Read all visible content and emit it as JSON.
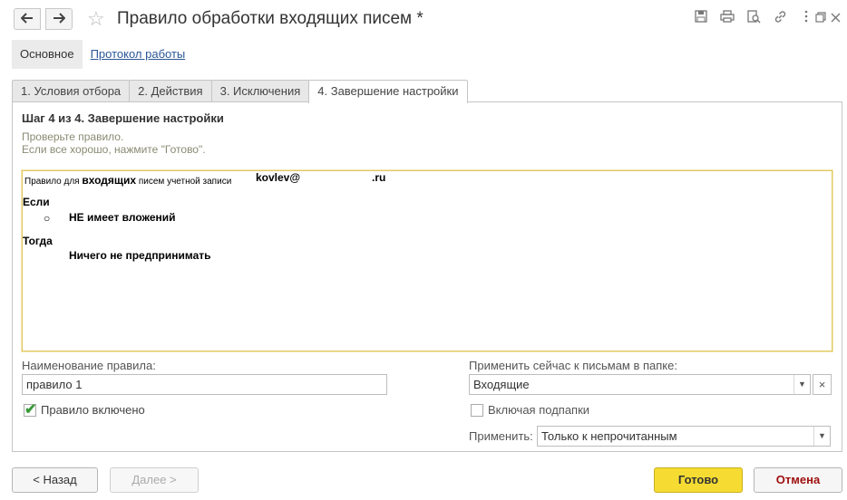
{
  "window": {
    "title": "Правило обработки входящих писем *",
    "back_icon": "🡐",
    "forward_icon": "🡒",
    "favorite_icon": "☆",
    "toolbar_icons": [
      "save-icon",
      "print-icon",
      "preview-icon",
      "link-icon",
      "more-icon",
      "restore-icon",
      "close-icon"
    ]
  },
  "subtabs": {
    "main_label": "Основное",
    "log_link": "Протокол работы"
  },
  "tabs": [
    {
      "label": "1. Условия отбора"
    },
    {
      "label": "2. Действия"
    },
    {
      "label": "3. Исключения"
    },
    {
      "label": "4. Завершение настройки",
      "active": true
    }
  ],
  "step": {
    "title": "Шаг 4 из 4. Завершение настройки",
    "hint1": "Проверьте правило.",
    "hint2": "Если все хорошо, нажмите \"Готово\"."
  },
  "preview": {
    "prefix": "Правило для ",
    "incoming": "входящих",
    "suffix": " писем учетной записи",
    "email": "kovlev@",
    "domain": ".ru",
    "if_label": "Если",
    "bullet": "○",
    "condition": "НЕ имеет вложений",
    "then_label": "Тогда",
    "action": "Ничего не предпринимать"
  },
  "form": {
    "rule_name_label": "Наименование правила:",
    "rule_name_value": "правило 1",
    "rule_enabled_label": "Правило включено",
    "rule_enabled": true,
    "apply_now_label": "Применить сейчас к письмам в папке:",
    "folder_value": "Входящие",
    "include_subfolders_label": "Включая подпапки",
    "include_subfolders": false,
    "apply_label": "Применить:",
    "apply_value": "Только к непрочитанным"
  },
  "buttons": {
    "back": "< Назад",
    "next": "Далее >",
    "done": "Готово",
    "cancel": "Отмена"
  }
}
